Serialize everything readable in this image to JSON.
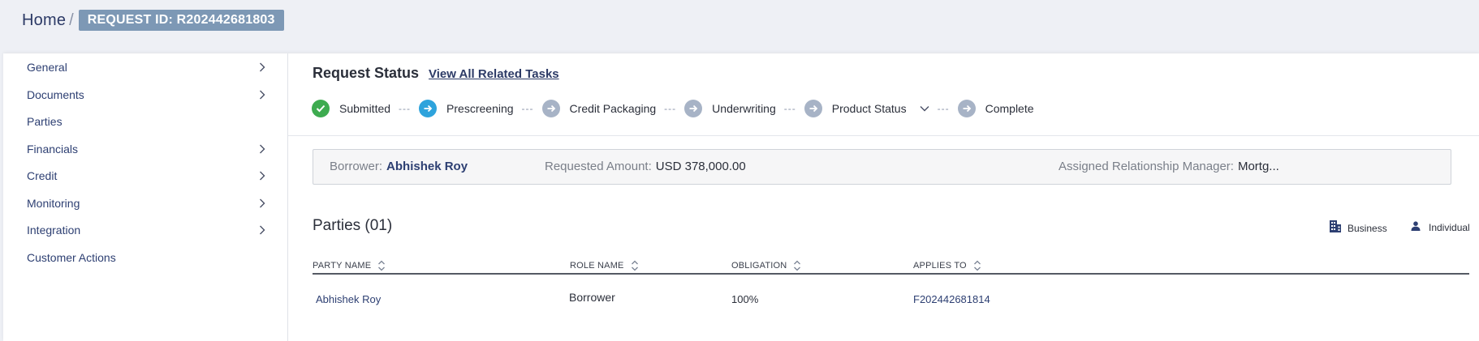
{
  "breadcrumb": {
    "home": "Home",
    "separator": "/",
    "request_id": "REQUEST ID: R202442681803"
  },
  "sidebar": {
    "items": [
      {
        "label": "General",
        "has_chevron": true
      },
      {
        "label": "Documents",
        "has_chevron": true
      },
      {
        "label": "Parties",
        "has_chevron": false
      },
      {
        "label": "Financials",
        "has_chevron": true
      },
      {
        "label": "Credit",
        "has_chevron": true
      },
      {
        "label": "Monitoring",
        "has_chevron": true
      },
      {
        "label": "Integration",
        "has_chevron": true
      },
      {
        "label": "Customer Actions",
        "has_chevron": false
      }
    ]
  },
  "request_status": {
    "title": "Request Status",
    "link": "View All Related Tasks",
    "separator": "---",
    "steps": [
      {
        "label": "Submitted",
        "state": "done",
        "icon": "check-icon"
      },
      {
        "label": "Prescreening",
        "state": "current",
        "icon": "arrow-right-icon"
      },
      {
        "label": "Credit Packaging",
        "state": "pending",
        "icon": "arrow-right-icon"
      },
      {
        "label": "Underwriting",
        "state": "pending",
        "icon": "arrow-right-icon"
      },
      {
        "label": "Product Status",
        "state": "pending",
        "icon": "arrow-right-icon",
        "dropdown": true
      },
      {
        "label": "Complete",
        "state": "pending",
        "icon": "arrow-right-icon"
      }
    ]
  },
  "summary": {
    "borrower_label": "Borrower:",
    "borrower_value": "Abhishek Roy",
    "amount_label": "Requested Amount:",
    "amount_value": "USD 378,000.00",
    "manager_label": "Assigned Relationship Manager:",
    "manager_value": "Mortg..."
  },
  "parties": {
    "title": "Parties (01)",
    "legend": [
      {
        "label": "Business",
        "icon": "building-icon"
      },
      {
        "label": "Individual",
        "icon": "person-icon"
      }
    ],
    "columns": [
      "PARTY NAME",
      "ROLE NAME",
      "OBLIGATION",
      "APPLIES TO"
    ],
    "rows": [
      {
        "party_name": "Abhishek Roy",
        "role_name": "Borrower",
        "obligation": "100%",
        "applies_to": "F202442681814"
      }
    ]
  },
  "colors": {
    "done": "#3dab4f",
    "current": "#2ea3dc",
    "pending": "#a7b3c6",
    "link": "#2c3a66",
    "request_id_bg": "#7d98b5"
  }
}
